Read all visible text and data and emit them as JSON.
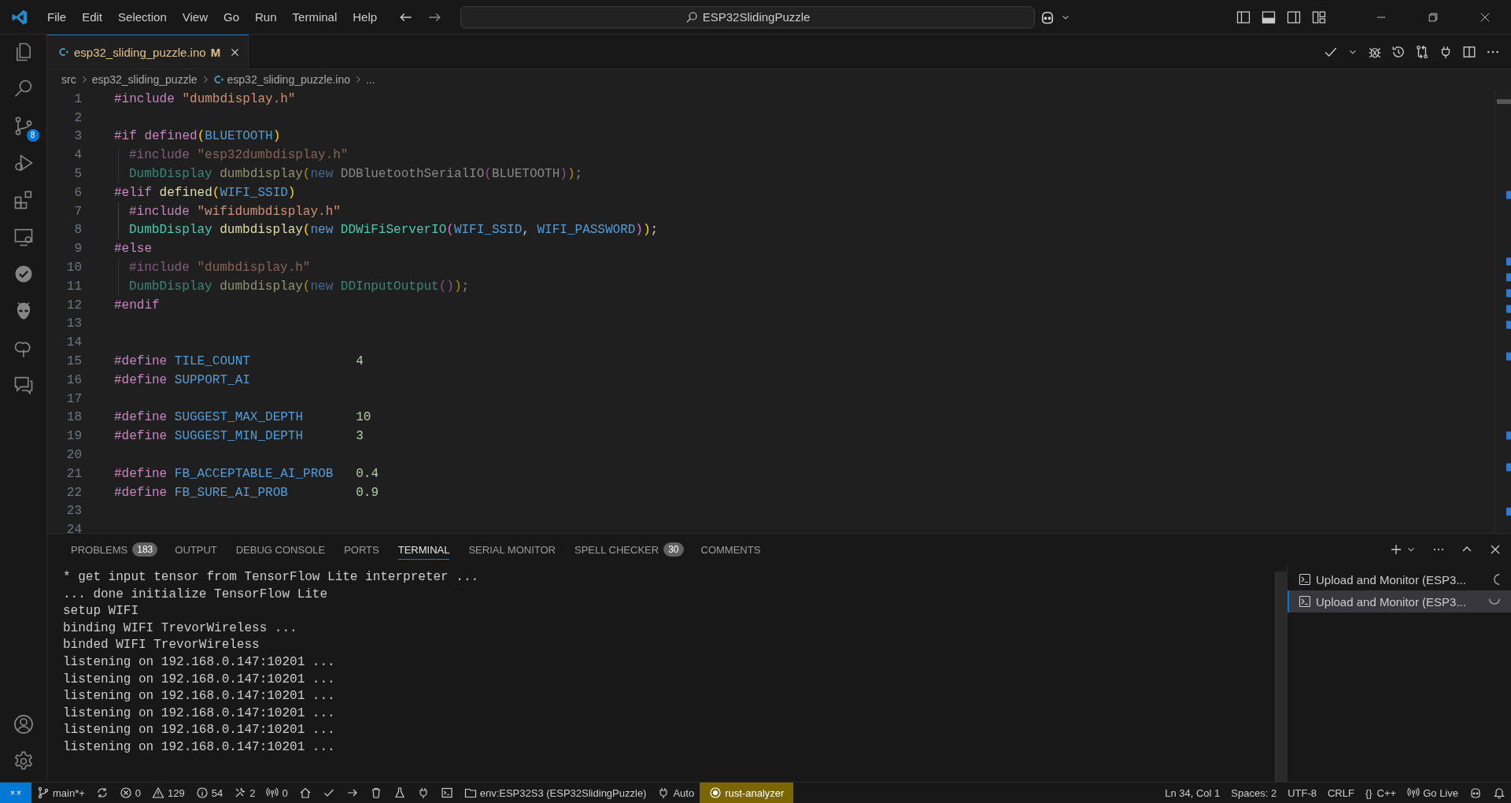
{
  "title_bar": {
    "menu": [
      "File",
      "Edit",
      "Selection",
      "View",
      "Go",
      "Run",
      "Terminal",
      "Help"
    ],
    "search": "ESP32SlidingPuzzle"
  },
  "activity_bar": {
    "source_control_badge": "8"
  },
  "editor": {
    "tab": {
      "label": "esp32_sliding_puzzle.ino",
      "status": "M",
      "modified": true
    },
    "breadcrumb": [
      {
        "kind": "folder",
        "text": "src"
      },
      {
        "kind": "folder",
        "text": "esp32_sliding_puzzle"
      },
      {
        "kind": "file",
        "text": "esp32_sliding_puzzle.ino"
      },
      {
        "kind": "symbol",
        "text": "..."
      }
    ],
    "lines": [
      {
        "number": "1",
        "indented": false,
        "inactive": false,
        "tokens": [
          {
            "kind": "directive",
            "text": "#include "
          },
          {
            "kind": "string",
            "text": "\"dumbdisplay.h\""
          }
        ]
      },
      {
        "number": "2"
      },
      {
        "number": "3",
        "indented": false,
        "inactive": false,
        "tokens": [
          {
            "kind": "directive",
            "text": "#if defined"
          },
          {
            "kind": "paren",
            "text": "("
          },
          {
            "kind": "macro",
            "text": "BLUETOOTH"
          },
          {
            "kind": "paren",
            "text": ")"
          }
        ]
      },
      {
        "number": "4",
        "indented": true,
        "inactive": true,
        "tokens": [
          {
            "kind": "directive",
            "text": "#include "
          },
          {
            "kind": "string",
            "text": "\"esp32dumbdisplay.h\""
          }
        ]
      },
      {
        "number": "5",
        "indented": true,
        "inactive": true,
        "tokens": [
          {
            "kind": "type",
            "text": "DumbDisplay "
          },
          {
            "kind": "function",
            "text": "dumbdisplay"
          },
          {
            "kind": "paren",
            "text": "("
          },
          {
            "kind": "keyword",
            "text": "new "
          },
          {
            "kind": "plain",
            "text": "DDBluetoothSerialIO"
          },
          {
            "kind": "paren2",
            "text": "("
          },
          {
            "kind": "plain",
            "text": "BLUETOOTH"
          },
          {
            "kind": "paren2",
            "text": ")"
          },
          {
            "kind": "paren",
            "text": ")"
          },
          {
            "kind": "plain",
            "text": ";"
          }
        ]
      },
      {
        "number": "6",
        "indented": false,
        "inactive": false,
        "tokens": [
          {
            "kind": "directive",
            "text": "#elif "
          },
          {
            "kind": "function",
            "text": "defined"
          },
          {
            "kind": "paren",
            "text": "("
          },
          {
            "kind": "macro",
            "text": "WIFI_SSID"
          },
          {
            "kind": "paren",
            "text": ")"
          }
        ]
      },
      {
        "number": "7",
        "indented": true,
        "inactive": false,
        "tokens": [
          {
            "kind": "directive",
            "text": "#include "
          },
          {
            "kind": "string",
            "text": "\"wifidumbdisplay.h\""
          }
        ]
      },
      {
        "number": "8",
        "indented": true,
        "inactive": false,
        "tokens": [
          {
            "kind": "type",
            "text": "DumbDisplay "
          },
          {
            "kind": "function",
            "text": "dumbdisplay"
          },
          {
            "kind": "paren",
            "text": "("
          },
          {
            "kind": "keyword",
            "text": "new "
          },
          {
            "kind": "type",
            "text": "DDWiFiServerIO"
          },
          {
            "kind": "paren2",
            "text": "("
          },
          {
            "kind": "macro",
            "text": "WIFI_SSID"
          },
          {
            "kind": "plain",
            "text": ", "
          },
          {
            "kind": "macro",
            "text": "WIFI_PASSWORD"
          },
          {
            "kind": "paren2",
            "text": ")"
          },
          {
            "kind": "paren",
            "text": ")"
          },
          {
            "kind": "plain",
            "text": ";"
          }
        ]
      },
      {
        "number": "9",
        "indented": false,
        "inactive": false,
        "tokens": [
          {
            "kind": "directive",
            "text": "#else"
          }
        ]
      },
      {
        "number": "10",
        "indented": true,
        "inactive": true,
        "tokens": [
          {
            "kind": "directive",
            "text": "#include "
          },
          {
            "kind": "string",
            "text": "\"dumbdisplay.h\""
          }
        ]
      },
      {
        "number": "11",
        "indented": true,
        "inactive": true,
        "tokens": [
          {
            "kind": "type",
            "text": "DumbDisplay "
          },
          {
            "kind": "function",
            "text": "dumbdisplay"
          },
          {
            "kind": "paren",
            "text": "("
          },
          {
            "kind": "keyword",
            "text": "new "
          },
          {
            "kind": "type",
            "text": "DDInputOutput"
          },
          {
            "kind": "paren2",
            "text": "()"
          },
          {
            "kind": "paren",
            "text": ")"
          },
          {
            "kind": "plain",
            "text": ";"
          }
        ]
      },
      {
        "number": "12",
        "indented": false,
        "inactive": false,
        "tokens": [
          {
            "kind": "directive",
            "text": "#endif"
          }
        ]
      },
      {
        "number": "13"
      },
      {
        "number": "14"
      },
      {
        "number": "15",
        "indented": false,
        "inactive": false,
        "tokens": [
          {
            "kind": "directive",
            "text": "#define "
          },
          {
            "kind": "macro",
            "text": "TILE_COUNT              "
          },
          {
            "kind": "number",
            "text": "4"
          }
        ]
      },
      {
        "number": "16",
        "indented": false,
        "inactive": false,
        "tokens": [
          {
            "kind": "directive",
            "text": "#define "
          },
          {
            "kind": "macro",
            "text": "SUPPORT_AI"
          }
        ]
      },
      {
        "number": "17"
      },
      {
        "number": "18",
        "indented": false,
        "inactive": false,
        "tokens": [
          {
            "kind": "directive",
            "text": "#define "
          },
          {
            "kind": "macro",
            "text": "SUGGEST_MAX_DEPTH       "
          },
          {
            "kind": "number",
            "text": "10"
          }
        ]
      },
      {
        "number": "19",
        "indented": false,
        "inactive": false,
        "tokens": [
          {
            "kind": "directive",
            "text": "#define "
          },
          {
            "kind": "macro",
            "text": "SUGGEST_MIN_DEPTH       "
          },
          {
            "kind": "number",
            "text": "3"
          }
        ]
      },
      {
        "number": "20"
      },
      {
        "number": "21",
        "indented": false,
        "inactive": false,
        "tokens": [
          {
            "kind": "directive",
            "text": "#define "
          },
          {
            "kind": "macro",
            "text": "FB_ACCEPTABLE_AI_PROB   "
          },
          {
            "kind": "number",
            "text": "0.4"
          }
        ]
      },
      {
        "number": "22",
        "indented": false,
        "inactive": false,
        "tokens": [
          {
            "kind": "directive",
            "text": "#define "
          },
          {
            "kind": "macro",
            "text": "FB_SURE_AI_PROB         "
          },
          {
            "kind": "number",
            "text": "0.9"
          }
        ]
      },
      {
        "number": "23"
      },
      {
        "number": "24"
      }
    ]
  },
  "panel": {
    "tabs": [
      {
        "label": "PROBLEMS",
        "badge": "183",
        "selected": false
      },
      {
        "label": "OUTPUT",
        "selected": false
      },
      {
        "label": "DEBUG CONSOLE",
        "selected": false
      },
      {
        "label": "PORTS",
        "selected": false
      },
      {
        "label": "TERMINAL",
        "selected": true
      },
      {
        "label": "SERIAL MONITOR",
        "selected": false
      },
      {
        "label": "SPELL CHECKER",
        "badge": "30",
        "selected": false
      },
      {
        "label": "COMMENTS",
        "selected": false
      }
    ],
    "terminal_lines": [
      "* get input tensor from TensorFlow Lite interpreter ...",
      "... done initialize TensorFlow Lite",
      "setup WIFI",
      "binding WIFI TrevorWireless ...",
      "binded WIFI TrevorWireless",
      "listening on 192.168.0.147:10201 ...",
      "listening on 192.168.0.147:10201 ...",
      "listening on 192.168.0.147:10201 ...",
      "listening on 192.168.0.147:10201 ...",
      "listening on 192.168.0.147:10201 ...",
      "listening on 192.168.0.147:10201 ..."
    ],
    "terminals": [
      {
        "label": "Upload and Monitor (ESP3...",
        "selected": false
      },
      {
        "label": "Upload and Monitor (ESP3...",
        "selected": true
      }
    ]
  },
  "status_bar": {
    "left": [
      {
        "kind": "remote"
      },
      {
        "kind": "branch",
        "text": "main*+"
      },
      {
        "kind": "sync"
      },
      {
        "kind": "errors",
        "text": "0"
      },
      {
        "kind": "warnings",
        "text": "129"
      },
      {
        "kind": "info",
        "text": "54"
      },
      {
        "kind": "tools",
        "text": "2"
      },
      {
        "kind": "ports",
        "text": "0"
      },
      {
        "kind": "home"
      },
      {
        "kind": "check"
      },
      {
        "kind": "arrow"
      },
      {
        "kind": "trash"
      },
      {
        "kind": "flask"
      },
      {
        "kind": "plug"
      },
      {
        "kind": "terminal"
      },
      {
        "kind": "env",
        "text": "env:ESP32S3 (ESP32SlidingPuzzle)"
      },
      {
        "kind": "plug",
        "text": "Auto"
      },
      {
        "kind": "highlight",
        "text": "rust-analyzer"
      }
    ],
    "right": [
      {
        "kind": "plain",
        "text": "Ln 34, Col 1"
      },
      {
        "kind": "plain",
        "text": "Spaces: 2"
      },
      {
        "kind": "plain",
        "text": "UTF-8"
      },
      {
        "kind": "plain",
        "text": "CRLF"
      },
      {
        "kind": "language",
        "glyph": "{}",
        "text": "C++"
      },
      {
        "kind": "live",
        "text": "Go Live"
      },
      {
        "kind": "copilot"
      },
      {
        "kind": "bell"
      }
    ]
  }
}
